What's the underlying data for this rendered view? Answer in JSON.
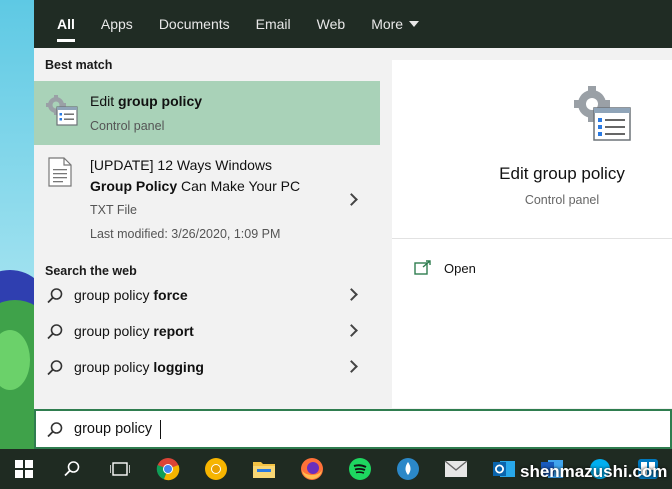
{
  "filters": {
    "tabs": [
      {
        "label": "All",
        "active": true
      },
      {
        "label": "Apps"
      },
      {
        "label": "Documents"
      },
      {
        "label": "Email"
      },
      {
        "label": "Web"
      },
      {
        "label": "More"
      }
    ]
  },
  "results": {
    "best_match_label": "Best match",
    "best_match": {
      "title_prefix": "Edit ",
      "title_bold": "group policy",
      "subtitle": "Control panel",
      "icon": "group-policy-icon"
    },
    "document": {
      "line1": "[UPDATE] 12 Ways Windows",
      "line2_bold": "Group Policy",
      "line2_rest": " Can Make Your PC",
      "type": "TXT File",
      "modified": "Last modified: 3/26/2020, 1:09 PM",
      "icon": "text-file-icon"
    },
    "web_label": "Search the web",
    "web_items": [
      {
        "prefix": "group policy ",
        "bold": "force"
      },
      {
        "prefix": "group policy ",
        "bold": "report"
      },
      {
        "prefix": "group policy ",
        "bold": "logging"
      }
    ]
  },
  "preview": {
    "title": "Edit group policy",
    "subtitle": "Control panel",
    "open_label": "Open"
  },
  "search": {
    "value": "group policy"
  },
  "taskbar": {
    "items": [
      "windows-start-icon",
      "search-icon",
      "task-view-icon",
      "chrome-icon",
      "chrome-canary-icon",
      "file-explorer-icon",
      "firefox-icon",
      "spotify-icon",
      "water-drop-app-icon",
      "mail-icon",
      "outlook-icon",
      "word-icon",
      "skype-icon",
      "trello-icon"
    ]
  },
  "watermark": "shenmazushi.com",
  "colors": {
    "accent": "#2f7d4f",
    "selected_row": "#a9d2b8",
    "filter_bar": "#202c24",
    "taskbar": "#1f2b22"
  }
}
